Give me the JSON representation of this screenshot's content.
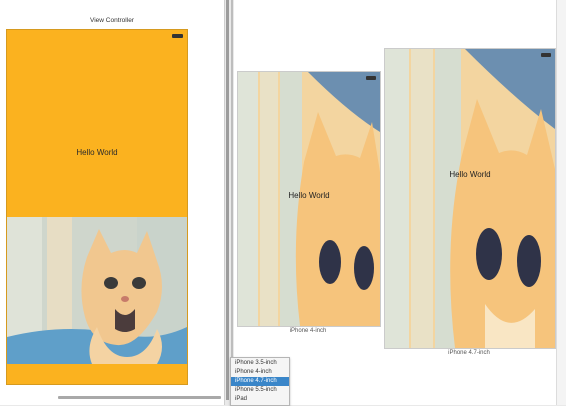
{
  "storyboard": {
    "title": "View Controller",
    "hello_label": "Hello World"
  },
  "preview": {
    "devices": [
      {
        "name": "iPhone 4-inch",
        "hello_label": "Hello World"
      },
      {
        "name": "iPhone 4.7-inch",
        "hello_label": "Hello World"
      }
    ]
  },
  "device_menu": {
    "items": [
      "iPhone 3.5-inch",
      "iPhone 4-inch",
      "iPhone 4.7-inch",
      "iPhone 5.5-inch",
      "iPad"
    ],
    "selected": "iPhone 4.7-inch"
  },
  "colors": {
    "scene_background": "#fbb21f",
    "menu_selection": "#3a86c9"
  }
}
